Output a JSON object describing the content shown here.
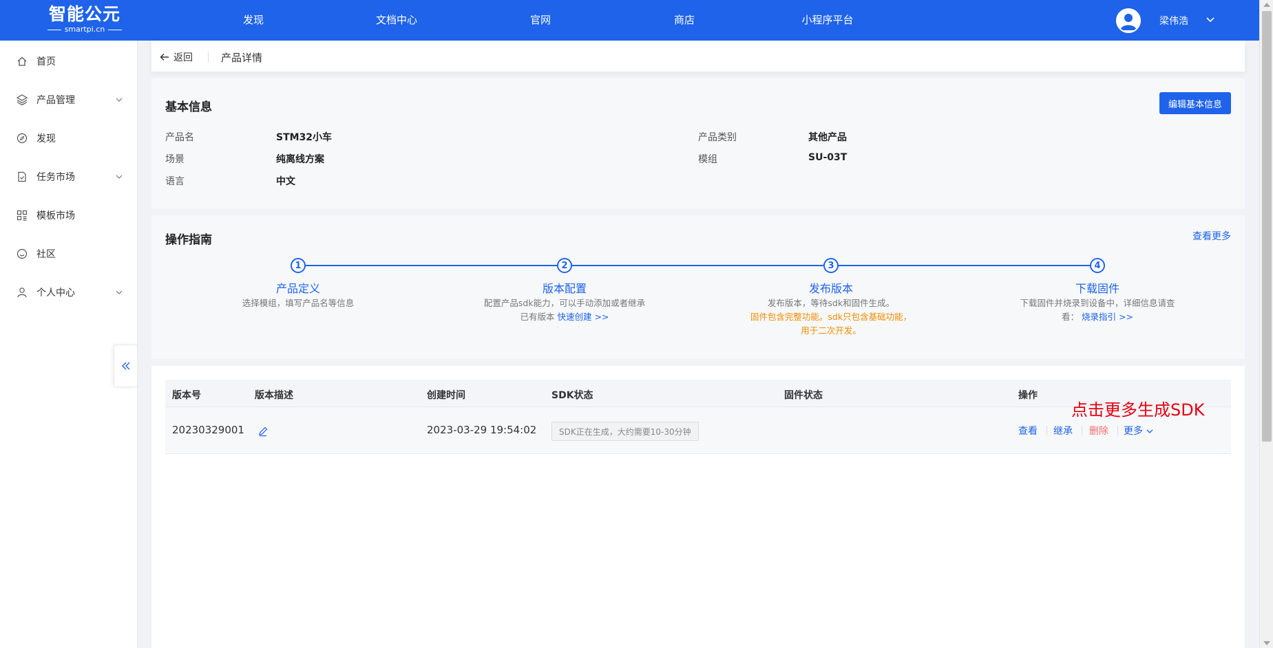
{
  "header": {
    "logo_main": "智能公元",
    "logo_sub": "smartpi.cn",
    "nav": [
      "发现",
      "文档中心",
      "官网",
      "商店",
      "小程序平台"
    ],
    "user_name": "梁伟浩"
  },
  "sidebar": {
    "items": [
      {
        "label": "首页",
        "icon": "home-icon",
        "has_caret": false
      },
      {
        "label": "产品管理",
        "icon": "layers-icon",
        "has_caret": true
      },
      {
        "label": "发现",
        "icon": "compass-icon",
        "has_caret": false
      },
      {
        "label": "任务市场",
        "icon": "task-icon",
        "has_caret": true
      },
      {
        "label": "模板市场",
        "icon": "template-icon",
        "has_caret": false
      },
      {
        "label": "社区",
        "icon": "smile-icon",
        "has_caret": false
      },
      {
        "label": "个人中心",
        "icon": "user-icon",
        "has_caret": true
      }
    ]
  },
  "breadcrumb": {
    "back_label": "返回",
    "title": "产品详情"
  },
  "basic_info": {
    "title": "基本信息",
    "edit_button": "编辑基本信息",
    "fields": {
      "product_name_label": "产品名",
      "product_name_value": "STM32小车",
      "scene_label": "场景",
      "scene_value": "纯离线方案",
      "language_label": "语言",
      "language_value": "中文",
      "category_label": "产品类别",
      "category_value": "其他产品",
      "module_label": "模组",
      "module_value": "SU-03T"
    }
  },
  "guide": {
    "title": "操作指南",
    "more_link": "查看更多",
    "steps": [
      {
        "num": "1",
        "title": "产品定义",
        "desc": "选择模组，填写产品名等信息"
      },
      {
        "num": "2",
        "title": "版本配置",
        "desc_a": "配置产品sdk能力，可以手动添加或者继承已有版本",
        "link": "快速创建 >>"
      },
      {
        "num": "3",
        "title": "发布版本",
        "desc_a": "发布版本，等待sdk和固件生成。",
        "warn": "固件包含完整功能。sdk只包含基础功能，用于二次开发。"
      },
      {
        "num": "4",
        "title": "下载固件",
        "desc_a": "下载固件并烧录到设备中，详细信息请查看：",
        "link": "烧录指引 >>"
      }
    ]
  },
  "versions_table": {
    "columns": [
      "版本号",
      "版本描述",
      "创建时间",
      "SDK状态",
      "固件状态",
      "操作"
    ],
    "rows": [
      {
        "version": "20230329001",
        "created": "2023-03-29 19:54:02",
        "sdk_status": "SDK正在生成，大约需要10-30分钟",
        "firmware_status": "",
        "actions": {
          "view": "查看",
          "inherit": "继承",
          "delete": "删除",
          "more": "更多"
        }
      }
    ]
  },
  "annotation": "点击更多生成SDK",
  "colors": {
    "primary": "#1e63e9",
    "danger": "#f56c6c",
    "warning": "#f08c00",
    "annotation": "#e60012"
  }
}
